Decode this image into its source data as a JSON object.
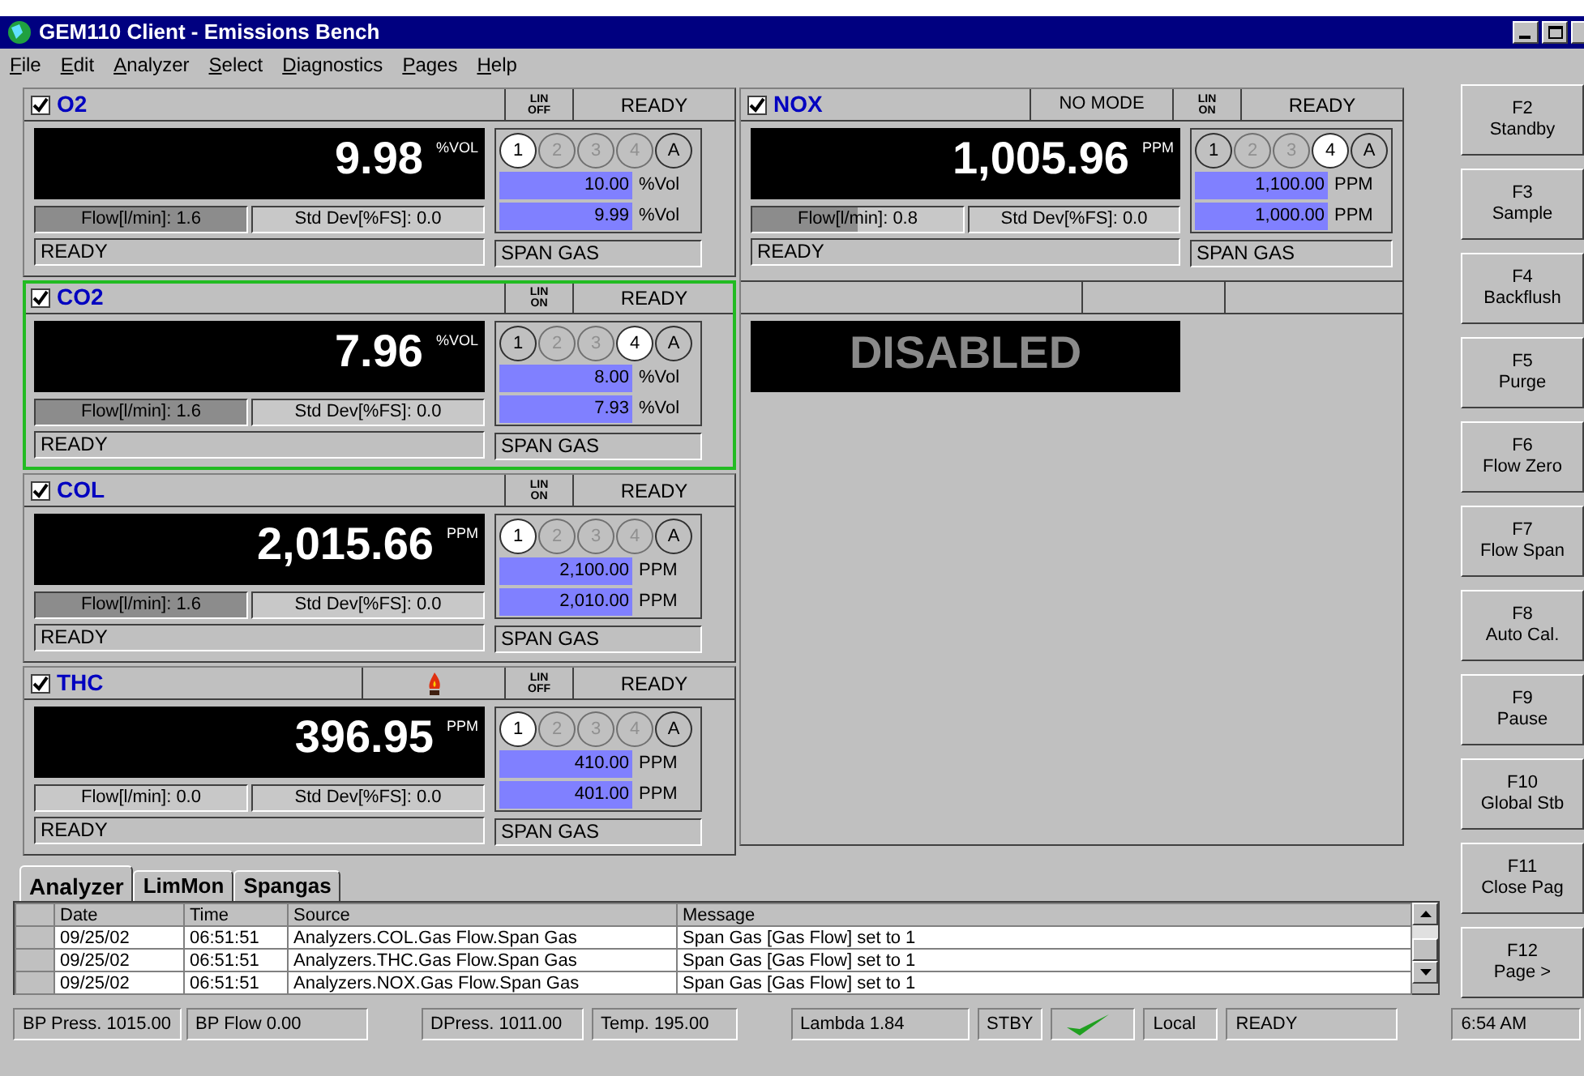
{
  "window": {
    "title": "GEM110 Client - Emissions Bench"
  },
  "menu": [
    "File",
    "Edit",
    "Analyzer",
    "Select",
    "Diagnostics",
    "Pages",
    "Help"
  ],
  "analyzers": [
    {
      "name": "O2",
      "checked": true,
      "highlighted": false,
      "lin_top": "LIN",
      "lin_bottom": "OFF",
      "state": "READY",
      "reading": "9.98",
      "unit": "%VOL",
      "ranges": [
        {
          "label": "1",
          "selected": true,
          "disabled": false
        },
        {
          "label": "2",
          "selected": false,
          "disabled": true
        },
        {
          "label": "3",
          "selected": false,
          "disabled": true
        },
        {
          "label": "4",
          "selected": false,
          "disabled": true
        },
        {
          "label": "A",
          "selected": false,
          "disabled": false
        }
      ],
      "span": [
        {
          "value": "10.00",
          "unit": "%Vol"
        },
        {
          "value": "9.99",
          "unit": "%Vol"
        }
      ],
      "flow": {
        "text": "Flow[l/min]: 1.6",
        "level": 1
      },
      "stddev": "Std Dev[%FS]: 0.0",
      "status": "READY",
      "gas": "SPAN GAS"
    },
    {
      "name": "CO2",
      "checked": true,
      "highlighted": true,
      "lin_top": "LIN",
      "lin_bottom": "ON",
      "state": "READY",
      "reading": "7.96",
      "unit": "%VOL",
      "ranges": [
        {
          "label": "1",
          "selected": false,
          "disabled": false
        },
        {
          "label": "2",
          "selected": false,
          "disabled": true
        },
        {
          "label": "3",
          "selected": false,
          "disabled": true
        },
        {
          "label": "4",
          "selected": true,
          "disabled": false
        },
        {
          "label": "A",
          "selected": false,
          "disabled": false
        }
      ],
      "span": [
        {
          "value": "8.00",
          "unit": "%Vol"
        },
        {
          "value": "7.93",
          "unit": "%Vol"
        }
      ],
      "flow": {
        "text": "Flow[l/min]: 1.6",
        "level": 1
      },
      "stddev": "Std Dev[%FS]: 0.0",
      "status": "READY",
      "gas": "SPAN GAS"
    },
    {
      "name": "COL",
      "checked": true,
      "highlighted": false,
      "lin_top": "LIN",
      "lin_bottom": "ON",
      "state": "READY",
      "reading": "2,015.66",
      "unit": "PPM",
      "ranges": [
        {
          "label": "1",
          "selected": true,
          "disabled": false
        },
        {
          "label": "2",
          "selected": false,
          "disabled": true
        },
        {
          "label": "3",
          "selected": false,
          "disabled": true
        },
        {
          "label": "4",
          "selected": false,
          "disabled": true
        },
        {
          "label": "A",
          "selected": false,
          "disabled": false
        }
      ],
      "span": [
        {
          "value": "2,100.00",
          "unit": "PPM"
        },
        {
          "value": "2,010.00",
          "unit": "PPM"
        }
      ],
      "flow": {
        "text": "Flow[l/min]: 1.6",
        "level": 1
      },
      "stddev": "Std Dev[%FS]: 0.0",
      "status": "READY",
      "gas": "SPAN GAS"
    },
    {
      "name": "THC",
      "checked": true,
      "highlighted": false,
      "flame": true,
      "lin_top": "LIN",
      "lin_bottom": "OFF",
      "state": "READY",
      "reading": "396.95",
      "unit": "PPM",
      "ranges": [
        {
          "label": "1",
          "selected": true,
          "disabled": false
        },
        {
          "label": "2",
          "selected": false,
          "disabled": true
        },
        {
          "label": "3",
          "selected": false,
          "disabled": true
        },
        {
          "label": "4",
          "selected": false,
          "disabled": true
        },
        {
          "label": "A",
          "selected": false,
          "disabled": false
        }
      ],
      "span": [
        {
          "value": "410.00",
          "unit": "PPM"
        },
        {
          "value": "401.00",
          "unit": "PPM"
        }
      ],
      "flow": {
        "text": "Flow[l/min]: 0.0",
        "level": 0
      },
      "stddev": "Std Dev[%FS]: 0.0",
      "status": "READY",
      "gas": "SPAN GAS"
    },
    {
      "name": "NOX",
      "checked": true,
      "highlighted": false,
      "mode": "NO MODE",
      "lin_top": "LIN",
      "lin_bottom": "ON",
      "state": "READY",
      "reading": "1,005.96",
      "unit": "PPM",
      "ranges": [
        {
          "label": "1",
          "selected": false,
          "disabled": false
        },
        {
          "label": "2",
          "selected": false,
          "disabled": true
        },
        {
          "label": "3",
          "selected": false,
          "disabled": true
        },
        {
          "label": "4",
          "selected": true,
          "disabled": false
        },
        {
          "label": "A",
          "selected": false,
          "disabled": false
        }
      ],
      "span": [
        {
          "value": "1,100.00",
          "unit": "PPM"
        },
        {
          "value": "1,000.00",
          "unit": "PPM"
        }
      ],
      "flow": {
        "text": "Flow[l/min]: 0.8",
        "level": 0.5
      },
      "stddev": "Std Dev[%FS]: 0.0",
      "status": "READY",
      "gas": "SPAN GAS"
    }
  ],
  "disabled_panel": {
    "text": "DISABLED"
  },
  "function_keys": [
    {
      "key": "F2",
      "label": "Standby"
    },
    {
      "key": "F3",
      "label": "Sample"
    },
    {
      "key": "F4",
      "label": "Backflush"
    },
    {
      "key": "F5",
      "label": "Purge"
    },
    {
      "key": "F6",
      "label": "Flow Zero"
    },
    {
      "key": "F7",
      "label": "Flow Span"
    },
    {
      "key": "F8",
      "label": "Auto Cal."
    },
    {
      "key": "F9",
      "label": "Pause"
    },
    {
      "key": "F10",
      "label": "Global Stb"
    },
    {
      "key": "F11",
      "label": "Close Pag"
    },
    {
      "key": "F12",
      "label": "Page >"
    }
  ],
  "tabs": [
    {
      "label": "Analyzer",
      "selected": true
    },
    {
      "label": "LimMon",
      "selected": false
    },
    {
      "label": "Spangas",
      "selected": false
    }
  ],
  "log": {
    "columns": [
      "Date",
      "Time",
      "Source",
      "Message"
    ],
    "rows": [
      [
        "09/25/02",
        "06:51:51",
        "Analyzers.COL.Gas Flow.Span Gas",
        "Span Gas [Gas Flow] set to  1"
      ],
      [
        "09/25/02",
        "06:51:51",
        "Analyzers.THC.Gas Flow.Span Gas",
        "Span Gas [Gas Flow] set to  1"
      ],
      [
        "09/25/02",
        "06:51:51",
        "Analyzers.NOX.Gas Flow.Span Gas",
        "Span Gas [Gas Flow] set to  1"
      ]
    ]
  },
  "status_bar": [
    {
      "kind": "text",
      "text": "BP Press. 1015.00"
    },
    {
      "kind": "text",
      "text": "BP Flow 0.00"
    },
    {
      "kind": "text",
      "text": "DPress. 1011.00"
    },
    {
      "kind": "text",
      "text": "Temp. 195.00"
    },
    {
      "kind": "text",
      "text": "Lambda 1.84"
    },
    {
      "kind": "text",
      "text": "STBY"
    },
    {
      "kind": "check"
    },
    {
      "kind": "text",
      "text": "Local"
    },
    {
      "kind": "text",
      "text": "READY"
    },
    {
      "kind": "text",
      "text": "6:54 AM"
    }
  ]
}
